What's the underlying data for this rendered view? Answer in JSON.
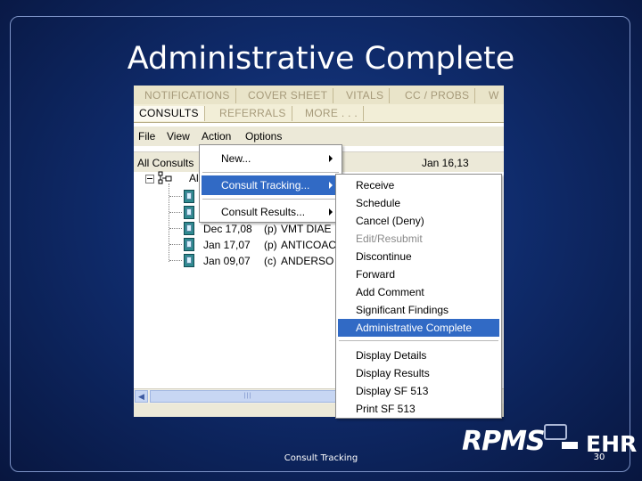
{
  "slide": {
    "title": "Administrative Complete",
    "footer": "Consult Tracking",
    "page_number": "30"
  },
  "logo": {
    "rpms": "RPMS",
    "ehr": "EHR"
  },
  "tabs": {
    "row1": [
      "NOTIFICATIONS",
      "COVER SHEET",
      "VITALS",
      "CC / PROBS",
      "W"
    ],
    "row2": [
      "CONSULTS",
      "REFERRALS",
      "MORE . . ."
    ],
    "active": "CONSULTS"
  },
  "menubar": {
    "items": [
      "File",
      "View",
      "Action",
      "Options"
    ]
  },
  "toolbar": {
    "all_consults": "All Consults",
    "date": "Jan 16,13"
  },
  "tree": {
    "root_label": "Al",
    "rows": [
      {
        "date": "",
        "status": "",
        "name": ""
      },
      {
        "date": "",
        "status": "",
        "name": ""
      },
      {
        "date": "Dec 17,08",
        "status": "(p)",
        "name": "VMT DIAE"
      },
      {
        "date": "Jan 17,07",
        "status": "(p)",
        "name": "ANTICOAC"
      },
      {
        "date": "Jan 09,07",
        "status": "(c)",
        "name": "ANDERSO"
      }
    ]
  },
  "scrollbar": {
    "left_arrow": "◀",
    "thumb_grip": "|||"
  },
  "action_menu": {
    "items": [
      {
        "label": "New...",
        "has_submenu": true,
        "highlighted": false
      },
      {
        "label": "Consult Tracking...",
        "has_submenu": true,
        "highlighted": true
      },
      {
        "label": "Consult Results...",
        "has_submenu": true,
        "highlighted": false
      }
    ]
  },
  "tracking_submenu": {
    "items": [
      {
        "label": "Receive",
        "enabled": true
      },
      {
        "label": "Schedule",
        "enabled": true
      },
      {
        "label": "Cancel (Deny)",
        "enabled": true
      },
      {
        "label": "Edit/Resubmit",
        "enabled": false
      },
      {
        "label": "Discontinue",
        "enabled": true
      },
      {
        "label": "Forward",
        "enabled": true
      },
      {
        "label": "Add Comment",
        "enabled": true
      },
      {
        "label": "Significant Findings",
        "enabled": true
      },
      {
        "label": "Administrative Complete",
        "enabled": true,
        "highlighted": true
      },
      {
        "label": "Display Details",
        "enabled": true
      },
      {
        "label": "Display Results",
        "enabled": true
      },
      {
        "label": "Display SF 513",
        "enabled": true
      },
      {
        "label": "Print SF 513",
        "enabled": true
      }
    ]
  },
  "colors": {
    "highlight": "#316ac5",
    "background": "#0f2b6b",
    "tab_inactive": "#a69a7a"
  }
}
